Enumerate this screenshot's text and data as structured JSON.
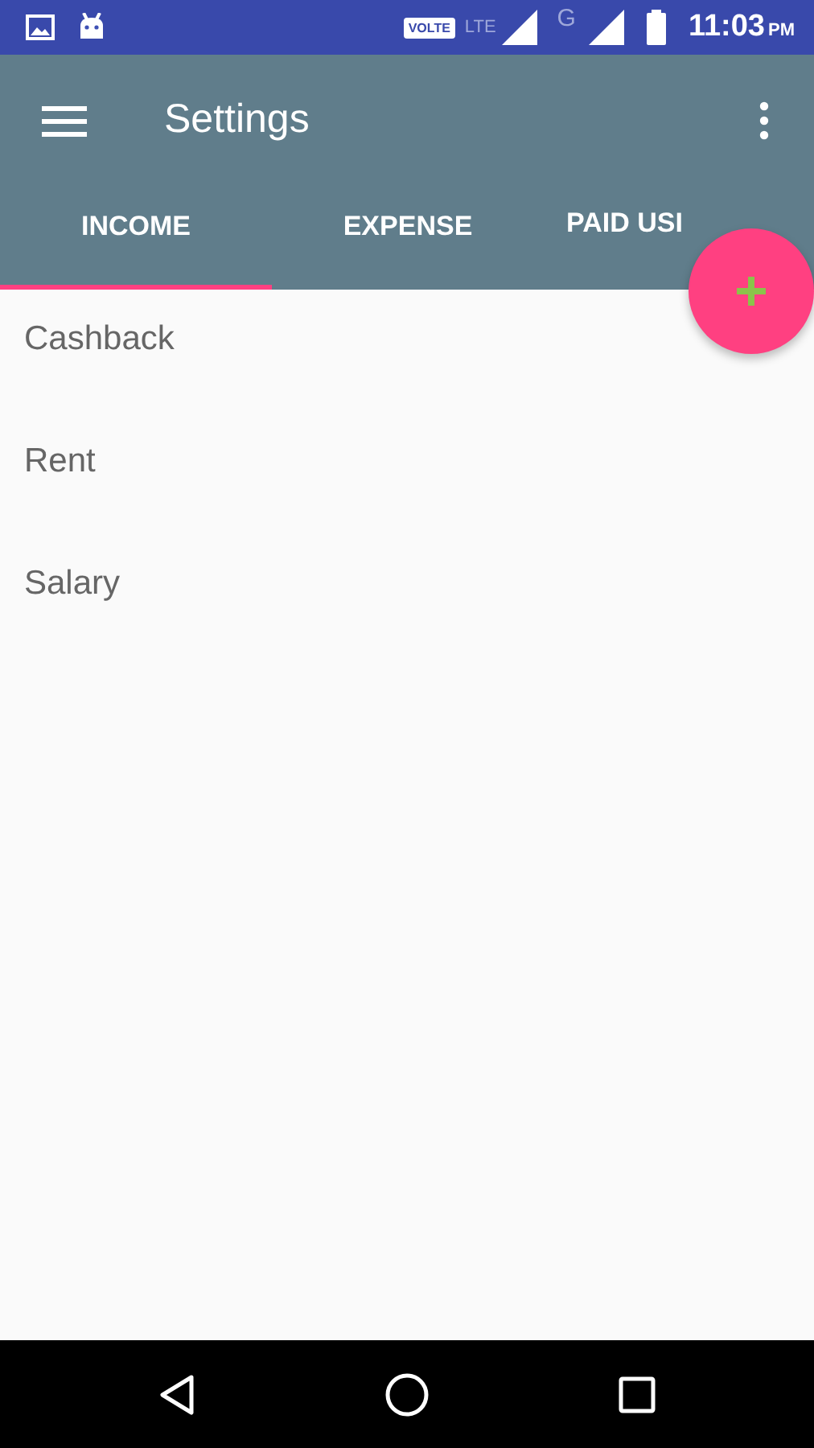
{
  "status_bar": {
    "volte": "VOLTE",
    "lte": "LTE",
    "network": "G",
    "time": "11:03",
    "ampm": "PM"
  },
  "toolbar": {
    "title": "Settings"
  },
  "tabs": [
    {
      "label": "INCOME",
      "selected": true
    },
    {
      "label": "EXPENSE",
      "selected": false
    },
    {
      "label": "PAID USI",
      "selected": false
    }
  ],
  "items": [
    "Cashback",
    "Rent",
    "Salary"
  ]
}
